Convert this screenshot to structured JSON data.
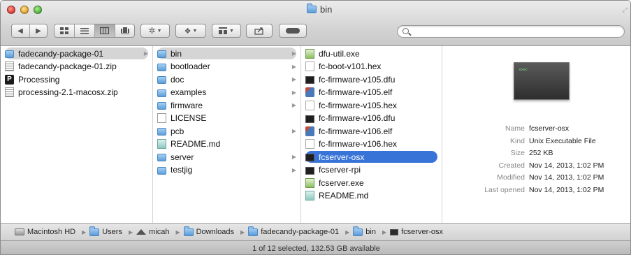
{
  "window": {
    "title": "bin"
  },
  "toolbar": {
    "nav": [
      "◀",
      "▶"
    ],
    "view_modes": [
      "icon-view",
      "list-view",
      "column-view",
      "cover-flow-view"
    ],
    "buttons": [
      "action",
      "arrange",
      "share",
      "tags"
    ]
  },
  "search": {
    "placeholder": ""
  },
  "column1": [
    {
      "label": "fadecandy-package-01",
      "icon": "folder-icon",
      "selected": "gray",
      "arrow": true
    },
    {
      "label": "fadecandy-package-01.zip",
      "icon": "zip-file-icon"
    },
    {
      "label": "Processing",
      "icon": "processing-app-icon"
    },
    {
      "label": "processing-2.1-macosx.zip",
      "icon": "zip-file-icon"
    }
  ],
  "column2": [
    {
      "label": "bin",
      "icon": "folder-icon",
      "selected": "gray",
      "arrow": true
    },
    {
      "label": "bootloader",
      "icon": "folder-icon",
      "arrow": true
    },
    {
      "label": "doc",
      "icon": "folder-icon",
      "arrow": true
    },
    {
      "label": "examples",
      "icon": "folder-icon",
      "arrow": true
    },
    {
      "label": "firmware",
      "icon": "folder-icon",
      "arrow": true
    },
    {
      "label": "LICENSE",
      "icon": "document-icon"
    },
    {
      "label": "pcb",
      "icon": "folder-icon",
      "arrow": true
    },
    {
      "label": "README.md",
      "icon": "markdown-file-icon"
    },
    {
      "label": "server",
      "icon": "folder-icon",
      "arrow": true
    },
    {
      "label": "testjig",
      "icon": "folder-icon",
      "arrow": true
    }
  ],
  "column3": [
    {
      "label": "dfu-util.exe",
      "icon": "windows-exe-icon"
    },
    {
      "label": "fc-boot-v101.hex",
      "icon": "hex-file-icon"
    },
    {
      "label": "fc-firmware-v105.dfu",
      "icon": "unix-executable-icon"
    },
    {
      "label": "fc-firmware-v105.elf",
      "icon": "elf-file-icon"
    },
    {
      "label": "fc-firmware-v105.hex",
      "icon": "hex-file-icon"
    },
    {
      "label": "fc-firmware-v106.dfu",
      "icon": "unix-executable-icon"
    },
    {
      "label": "fc-firmware-v106.elf",
      "icon": "elf-file-icon"
    },
    {
      "label": "fc-firmware-v106.hex",
      "icon": "hex-file-icon"
    },
    {
      "label": "fcserver-osx",
      "icon": "unix-executable-icon",
      "selected": "blue"
    },
    {
      "label": "fcserver-rpi",
      "icon": "unix-executable-icon"
    },
    {
      "label": "fcserver.exe",
      "icon": "windows-exe-icon"
    },
    {
      "label": "README.md",
      "icon": "markdown-file-icon"
    }
  ],
  "preview": {
    "thumb_label": "exec",
    "info": [
      {
        "key": "Name",
        "value": "fcserver-osx"
      },
      {
        "key": "Kind",
        "value": "Unix Executable File"
      },
      {
        "key": "Size",
        "value": "252 KB"
      },
      {
        "key": "Created",
        "value": "Nov 14, 2013, 1:02 PM"
      },
      {
        "key": "Modified",
        "value": "Nov 14, 2013, 1:02 PM"
      },
      {
        "key": "Last opened",
        "value": "Nov 14, 2013, 1:02 PM"
      }
    ]
  },
  "pathbar": [
    {
      "label": "Macintosh HD",
      "icon": "hard-drive-icon"
    },
    {
      "label": "Users",
      "icon": "folder-icon"
    },
    {
      "label": "micah",
      "icon": "home-icon"
    },
    {
      "label": "Downloads",
      "icon": "folder-icon"
    },
    {
      "label": "fadecandy-package-01",
      "icon": "folder-icon"
    },
    {
      "label": "bin",
      "icon": "folder-icon"
    },
    {
      "label": "fcserver-osx",
      "icon": "unix-executable-icon"
    }
  ],
  "status": {
    "text": "1 of 12 selected, 132.53 GB available"
  }
}
